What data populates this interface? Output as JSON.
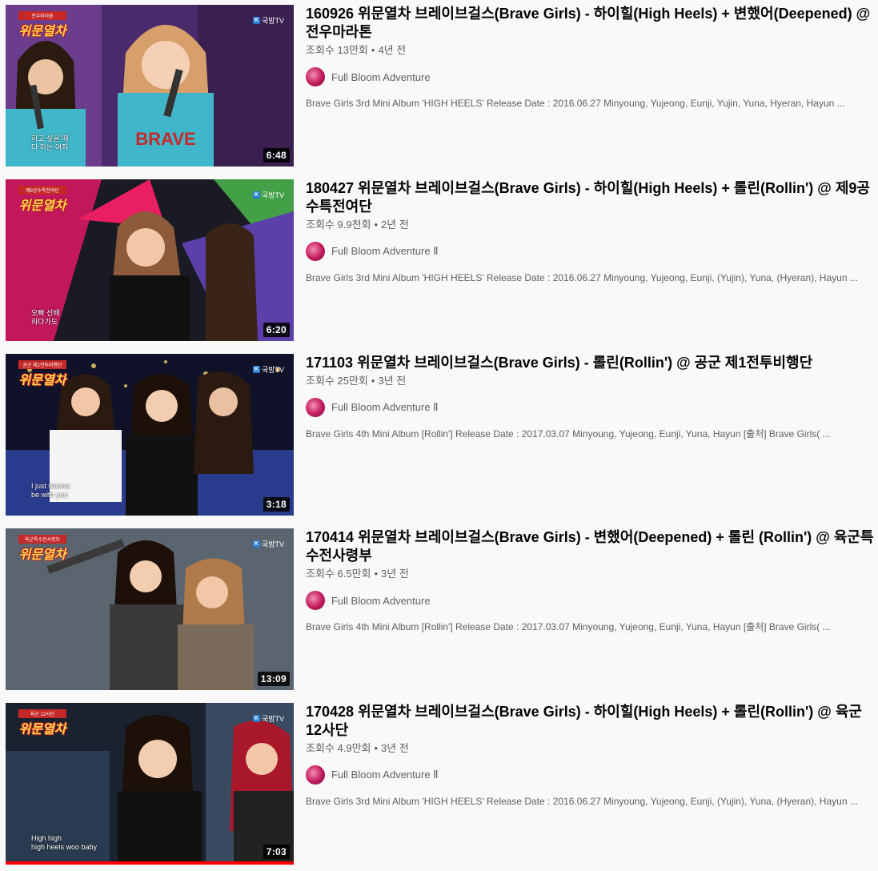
{
  "videos": [
    {
      "title": "160926 위문열차 브레이브걸스(Brave Girls) - 하이힐(High Heels) + 변했어(Deepened) @ 전우마라톤",
      "views": "조회수 13만회",
      "age": "4년 전",
      "channel": "Full Bloom Adventure",
      "description": "Brave Girls 3rd Mini Album 'HIGH HEELS' Release Date : 2016.06.27 Minyoung, Yujeong, Eunji, Yujin, Yuna, Hyeran, Hayun ...",
      "duration": "6:48",
      "show_logo_small": "전우마라톤",
      "show_logo_big": "위문열차",
      "station": "국방TV",
      "subtitle": "하고 싶을 때\n다 하는 여자"
    },
    {
      "title": "180427 위문열차 브레이브걸스(Brave Girls) - 하이힐(High Heels) + 롤린(Rollin') @ 제9공수특전여단",
      "views": "조회수 9.9천회",
      "age": "2년 전",
      "channel": "Full Bloom Adventure Ⅱ",
      "description": "Brave Girls 3rd Mini Album 'HIGH HEELS' Release Date : 2016.06.27 Minyoung, Yujeong, Eunji, (Yujin), Yuna, (Hyeran), Hayun ...",
      "duration": "6:20",
      "show_logo_small": "제9공수특전여단",
      "show_logo_big": "위문열차",
      "station": "국방TV",
      "subtitle": "오빠 선배\n하다가도"
    },
    {
      "title": "171103 위문열차 브레이브걸스(Brave Girls) - 롤린(Rollin') @ 공군 제1전투비행단",
      "views": "조회수 25만회",
      "age": "3년 전",
      "channel": "Full Bloom Adventure Ⅱ",
      "description": "Brave Girls 4th Mini Album [Rollin'] Release Date : 2017.03.07 Minyoung, Yujeong, Eunji, Yuna, Hayun [출처] Brave Girls( ...",
      "duration": "3:18",
      "show_logo_small": "공군 제1전투비행단",
      "show_logo_big": "위문열차",
      "station": "국방TV",
      "subtitle": "I just wanna\nbe with you"
    },
    {
      "title": "170414 위문열차 브레이브걸스(Brave Girls) - 변했어(Deepened) + 롤린 (Rollin') @ 육군특수전사령부",
      "views": "조회수 6.5만회",
      "age": "3년 전",
      "channel": "Full Bloom Adventure",
      "description": "Brave Girls 4th Mini Album [Rollin'] Release Date : 2017.03.07 Minyoung, Yujeong, Eunji, Yuna, Hayun [출처] Brave Girls( ...",
      "duration": "13:09",
      "show_logo_small": "육군특수전사령부",
      "show_logo_big": "위문열차",
      "station": "국방TV",
      "subtitle": ""
    },
    {
      "title": "170428 위문열차 브레이브걸스(Brave Girls) - 하이힐(High Heels) + 롤린(Rollin') @ 육군 12사단",
      "views": "조회수 4.9만회",
      "age": "3년 전",
      "channel": "Full Bloom Adventure Ⅱ",
      "description": "Brave Girls 3rd Mini Album 'HIGH HEELS' Release Date : 2016.06.27 Minyoung, Yujeong, Eunji, (Yujin), Yuna, (Hyeran), Hayun ...",
      "duration": "7:03",
      "show_logo_small": "육군 12사단",
      "show_logo_big": "위문열차",
      "station": "국방TV",
      "subtitle": "High high\nhigh heels woo baby",
      "watched_progress": 1.0
    }
  ],
  "colors": {
    "title": "#030303",
    "secondary": "#606060",
    "background": "#f9f9f9",
    "progress": "#ff0000"
  },
  "icons": {
    "station": "kbs-logo-icon",
    "avatar": "channel-avatar-icon"
  }
}
